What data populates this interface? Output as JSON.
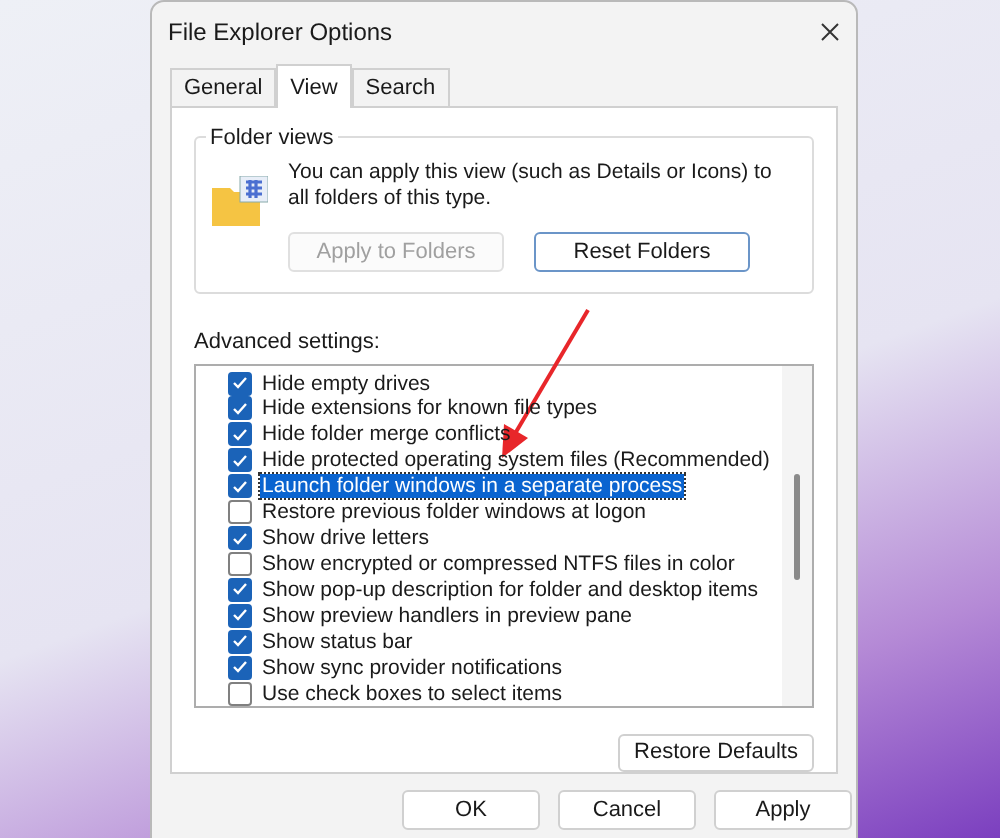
{
  "window": {
    "title": "File Explorer Options"
  },
  "tabs": [
    {
      "label": "General",
      "selected": false
    },
    {
      "label": "View",
      "selected": true
    },
    {
      "label": "Search",
      "selected": false
    }
  ],
  "folder_views": {
    "title": "Folder views",
    "description": "You can apply this view (such as Details or Icons) to all folders of this type.",
    "buttons": [
      {
        "label": "Apply to Folders",
        "disabled": true
      },
      {
        "label": "Reset Folders",
        "disabled": false
      }
    ]
  },
  "advanced_settings": {
    "label": "Advanced settings:",
    "items": [
      {
        "label": "Hide empty drives",
        "checked": true,
        "selected": false
      },
      {
        "label": "Hide extensions for known file types",
        "checked": true,
        "selected": false
      },
      {
        "label": "Hide folder merge conflicts",
        "checked": true,
        "selected": false
      },
      {
        "label": "Hide protected operating system files (Recommended)",
        "checked": true,
        "selected": false
      },
      {
        "label": "Launch folder windows in a separate process",
        "checked": true,
        "selected": true
      },
      {
        "label": "Restore previous folder windows at logon",
        "checked": false,
        "selected": false
      },
      {
        "label": "Show drive letters",
        "checked": true,
        "selected": false
      },
      {
        "label": "Show encrypted or compressed NTFS files in color",
        "checked": false,
        "selected": false
      },
      {
        "label": "Show pop-up description for folder and desktop items",
        "checked": true,
        "selected": false
      },
      {
        "label": "Show preview handlers in preview pane",
        "checked": true,
        "selected": false
      },
      {
        "label": "Show status bar",
        "checked": true,
        "selected": false
      },
      {
        "label": "Show sync provider notifications",
        "checked": true,
        "selected": false
      },
      {
        "label": "Use check boxes to select items",
        "checked": false,
        "selected": false
      }
    ]
  },
  "restore_defaults": {
    "label": "Restore Defaults"
  },
  "footer_buttons": [
    {
      "label": "OK"
    },
    {
      "label": "Cancel"
    },
    {
      "label": "Apply"
    }
  ]
}
